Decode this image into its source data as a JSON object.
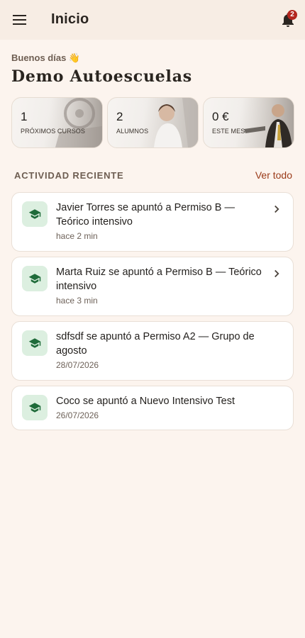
{
  "app_bar": {
    "title": "Inicio",
    "menu_icon": "menu-icon",
    "notifications_icon": "bell-icon",
    "notifications_count": "2"
  },
  "header": {
    "greeting": "Buenos días 👋",
    "org_name": "Demo Autoescuelas"
  },
  "stats": [
    {
      "value": "1",
      "label": "PRÓXIMOS CURSOS"
    },
    {
      "value": "2",
      "label": "ALUMNOS"
    },
    {
      "value": "0 €",
      "label": "ESTE MES"
    }
  ],
  "activity": {
    "section_title": "ACTIVIDAD RECIENTE",
    "see_all_label": "Ver todo",
    "items": [
      {
        "text": "Javier Torres se apuntó a Permiso B — Teórico intensivo",
        "time": "hace 2 min",
        "icon": "graduation-cap-icon",
        "chevron": true
      },
      {
        "text": "Marta Ruiz se apuntó a Permiso B — Teórico intensivo",
        "time": "hace 3 min",
        "icon": "graduation-cap-icon",
        "chevron": true
      },
      {
        "text": "sdfsdf se apuntó a Permiso A2 — Grupo de agosto",
        "time": "28/07/2026",
        "icon": "graduation-cap-icon",
        "chevron": false
      },
      {
        "text": "Coco se apuntó a Nuevo Intensivo Test",
        "time": "26/07/2026",
        "icon": "graduation-cap-icon",
        "chevron": false
      }
    ]
  },
  "colors": {
    "background": "#fcf4ee",
    "app_bar": "#f7ede4",
    "accent": "#9a3a18",
    "badge": "#b3261e",
    "icon_bg": "#dcefe0",
    "icon_fg": "#1f6b3a"
  }
}
